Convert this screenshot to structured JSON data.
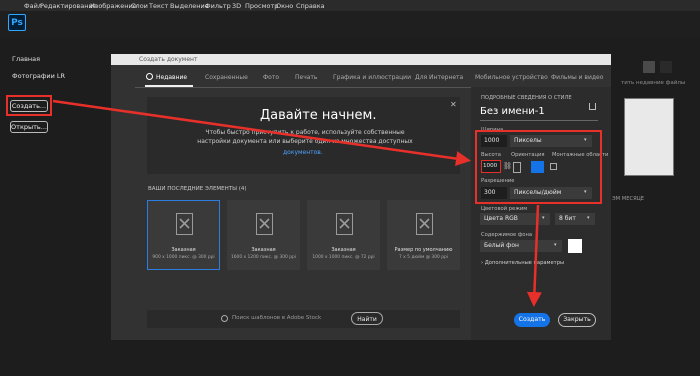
{
  "menu": [
    "Файл",
    "Редактирование",
    "Изображение",
    "Слои",
    "Текст",
    "Выделение",
    "Фильтр",
    "3D",
    "Просмотр",
    "Окно",
    "Справка"
  ],
  "app": {
    "logo": "Ps"
  },
  "sidebar": {
    "home": "Главная",
    "lr_photos": "Фотографии LR",
    "create_button": "Создать...",
    "open_button": "Открыть..."
  },
  "dialog": {
    "title": "Создать документ",
    "tabs": [
      "Недавние",
      "Сохраненные",
      "Фото",
      "Печать",
      "Графика и иллюстрации",
      "Для Интернета",
      "Мобильное устройство",
      "Фильмы и видео"
    ],
    "welcome_title": "Давайте начнем.",
    "welcome_text": "Чтобы быстро приступить к работе, используйте собственные настройки документа или выберите один из множества доступных",
    "welcome_link": "документов.",
    "recent_label": "ВАШИ ПОСЛЕДНИЕ ЭЛЕМЕНТЫ",
    "recent_count": "(4)",
    "presets": [
      {
        "name": "Заказная",
        "desc": "900 x 1000 пикс. @ 300 ppi"
      },
      {
        "name": "Заказная",
        "desc": "1600 x 1200 пикс. @ 300 ppi"
      },
      {
        "name": "Заказная",
        "desc": "1000 x 1000 пикс. @ 72 ppi"
      },
      {
        "name": "Размер по умолчанию",
        "desc": "7 x 5 дюйм @ 300 ppi"
      }
    ],
    "search_placeholder": "Поиск шаблонов в Adobe Stock",
    "find_button": "Найти"
  },
  "details": {
    "header": "ПОДРОБНЫЕ СВЕДЕНИЯ О СТИЛЕ",
    "doc_name": "Без имени-1",
    "width_label": "Ширина",
    "width_value": "1000",
    "width_unit": "Пикселы",
    "height_label": "Высота",
    "height_value": "1000",
    "orientation_label": "Ориентация",
    "artboards_label": "Монтажные области",
    "resolution_label": "Разрешение",
    "resolution_value": "300",
    "resolution_unit": "Пикселы/дюйм",
    "color_mode_label": "Цветовой режим",
    "color_mode_value": "Цвета RGB",
    "bit_depth": "8 бит",
    "background_label": "Содержимое фона",
    "background_value": "Белый фон",
    "advanced": "Дополнительные параметры",
    "create_button": "Создать",
    "close_button": "Закрыть"
  },
  "background": {
    "recent_files_hint": "тить недавние файлы",
    "month_hint": "ЭМ МЕСЯЦЕ"
  },
  "colors": {
    "accent": "#1473e6",
    "highlight": "#e8302a"
  }
}
